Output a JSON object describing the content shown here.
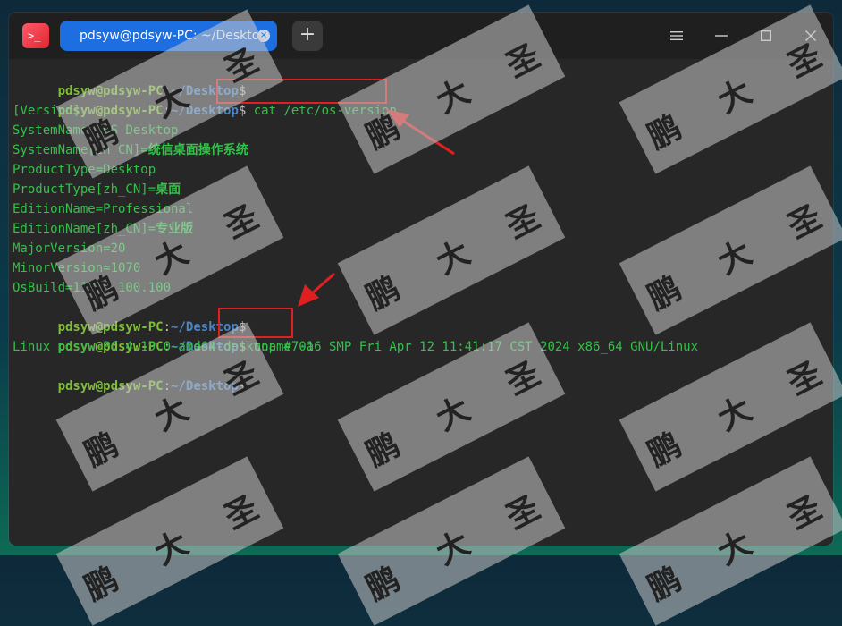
{
  "window": {
    "tab_title": "pdsyw@pdsyw-PC: ~/Desktop",
    "tab_close_glyph": "×",
    "new_tab_glyph": "+",
    "app_icon_glyph": ">_"
  },
  "prompt": {
    "user": "pdsyw@pdsyw-PC",
    "colon": ":",
    "path": "~/Desktop",
    "dollar": "$"
  },
  "commands": {
    "cmd1": " cat /etc/os-version",
    "cmd2": " uname -a"
  },
  "output": {
    "l1": "[Version]",
    "l2": "SystemName=UOS Desktop",
    "l3a": "SystemName[zh_CN]=",
    "l3b": "统信桌面操作系统",
    "l4": "ProductType=Desktop",
    "l5a": "ProductType[zh_CN]=",
    "l5b": "桌面",
    "l6": "EditionName=Professional",
    "l7a": "EditionName[zh_CN]=",
    "l7b": "专业版",
    "l8": "MajorVersion=20",
    "l9": "MinorVersion=1070",
    "l10": "OsBuild=11018.100.100",
    "uname": "Linux pdsyw-PC 4.19.0-amd64-desktop #7016 SMP Fri Apr 12 11:41:17 CST 2024 x86_64 GNU/Linux"
  },
  "watermark": {
    "c1": "鹏",
    "c2": "大",
    "c3": "圣"
  },
  "colors": {
    "accent_tab": "#1d6ee0",
    "terminal_bg": "#272727",
    "prompt_user": "#7fbe36",
    "prompt_path": "#4a86c8",
    "output_green": "#34c04a",
    "annotation_red": "#e02020"
  }
}
